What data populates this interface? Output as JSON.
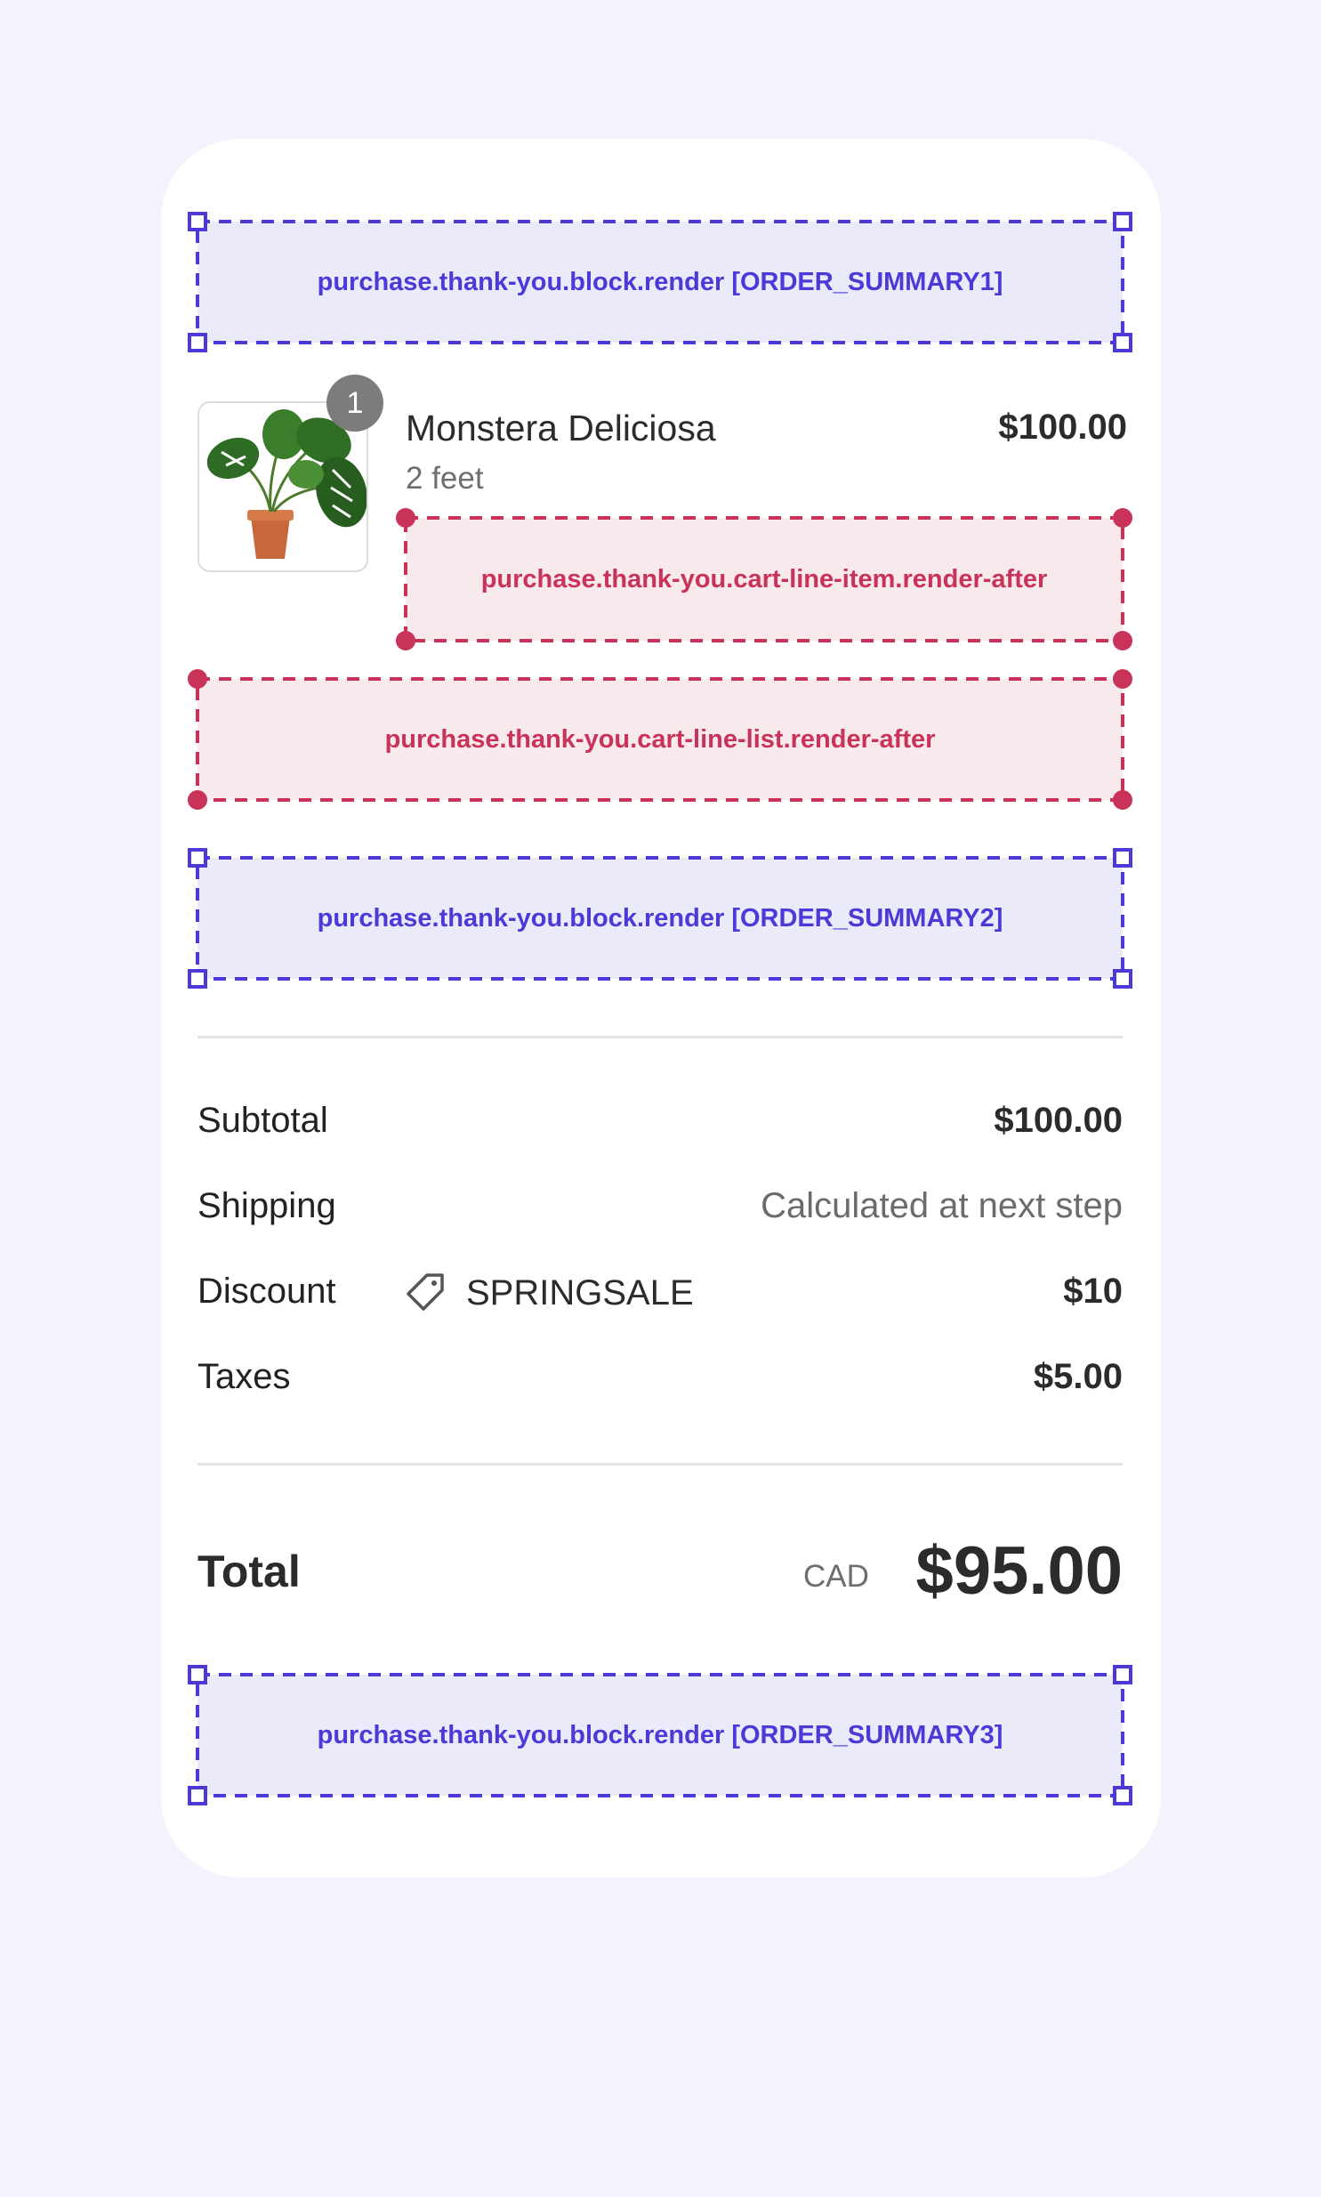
{
  "targets": {
    "order_summary1": "purchase.thank-you.block.render [ORDER_SUMMARY1]",
    "cart_line_item_after": "purchase.thank-you.cart-line-item.render-after",
    "cart_line_list_after": "purchase.thank-you.cart-line-list.render-after",
    "order_summary2": "purchase.thank-you.block.render [ORDER_SUMMARY2]",
    "order_summary3": "purchase.thank-you.block.render [ORDER_SUMMARY3]"
  },
  "product": {
    "quantity": "1",
    "name": "Monstera Deliciosa",
    "variant": "2 feet",
    "price": "$100.00",
    "image_icon": "monstera-plant-image"
  },
  "summary": {
    "subtotal_label": "Subtotal",
    "subtotal_value": "$100.00",
    "shipping_label": "Shipping",
    "shipping_value": "Calculated at next step",
    "discount_label": "Discount",
    "discount_code": "SPRINGSALE",
    "discount_icon": "tag-icon",
    "discount_value": "$10",
    "taxes_label": "Taxes",
    "taxes_value": "$5.00",
    "total_label": "Total",
    "currency": "CAD",
    "total_value": "$95.00"
  },
  "colors": {
    "blue_target": "#4b3ad8",
    "red_target": "#c93259",
    "background": "#f3f2fd"
  }
}
